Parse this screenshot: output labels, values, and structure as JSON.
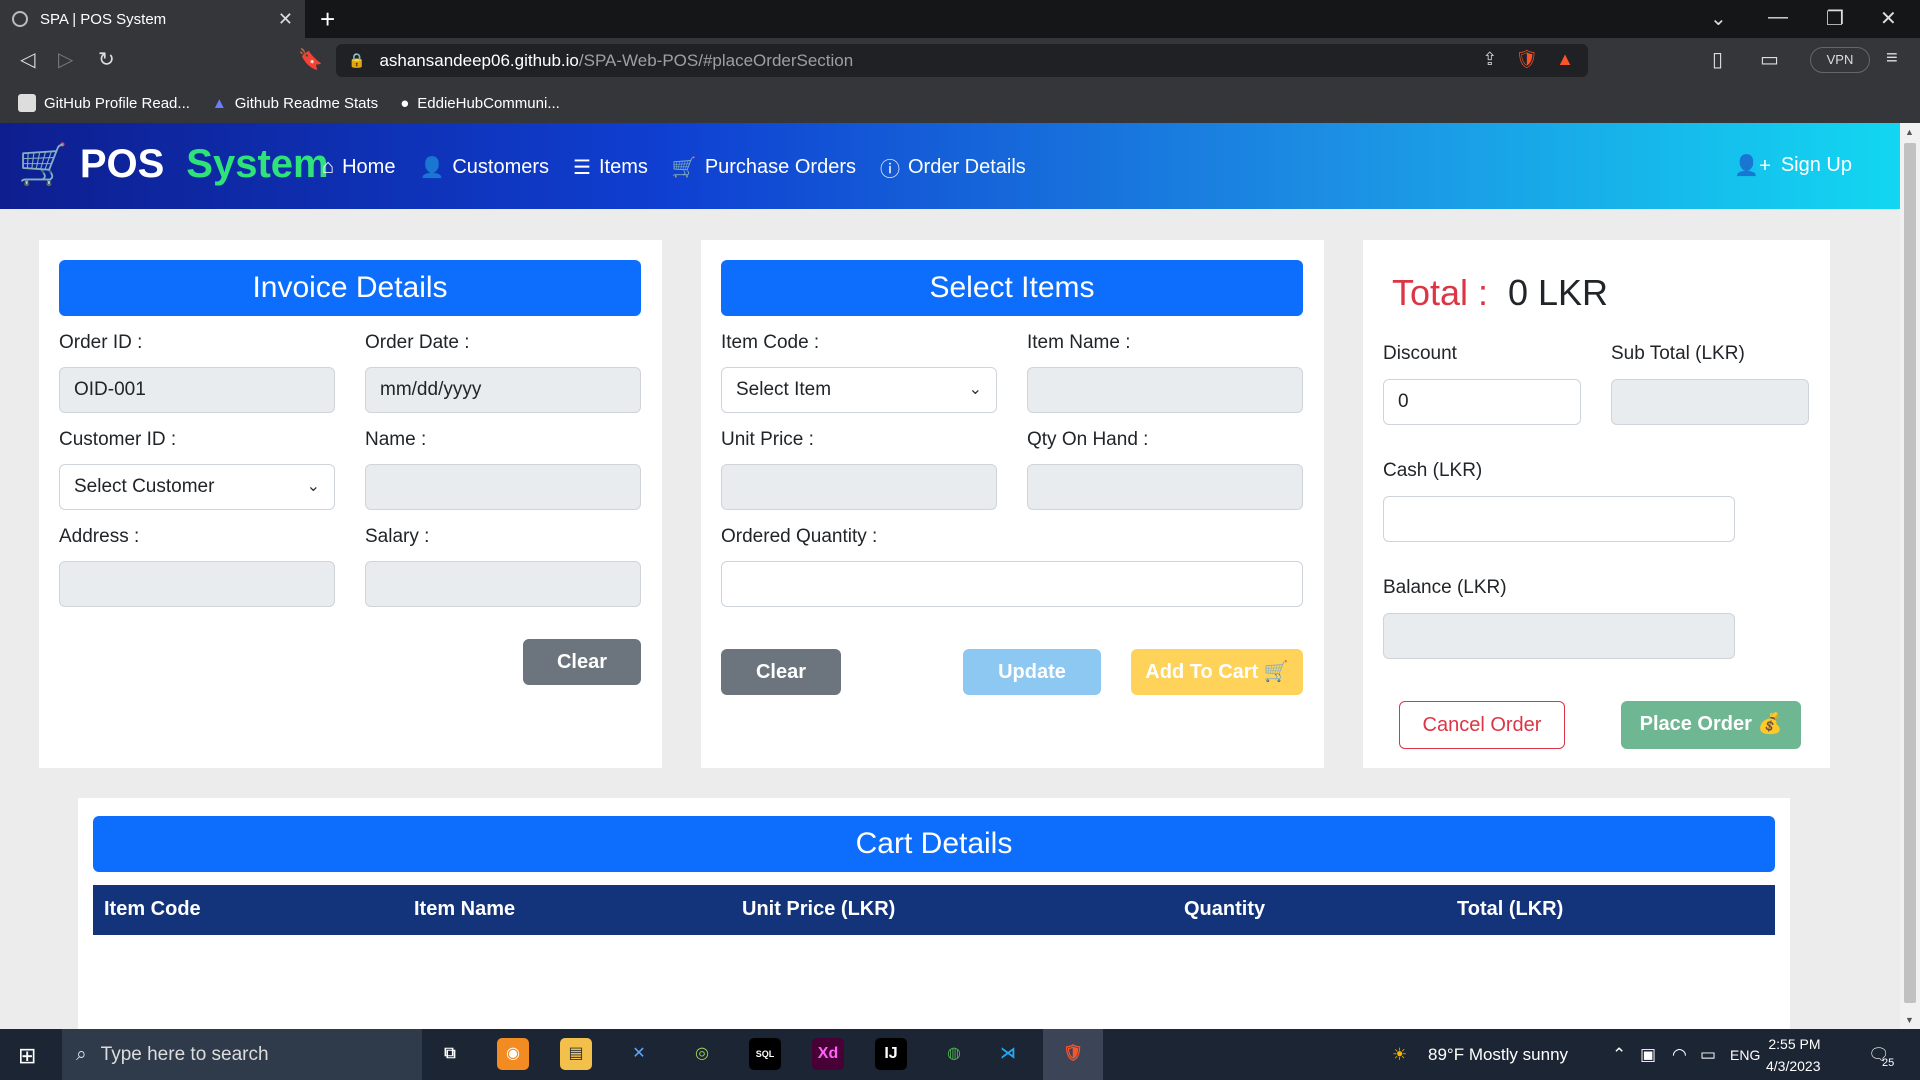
{
  "browser": {
    "tab_title": "SPA | POS System",
    "url_host": "ashansandeep06.github.io",
    "url_path": "/SPA-Web-POS/#placeOrderSection",
    "vpn_label": "VPN",
    "bookmarks": [
      {
        "label": "GitHub Profile Read..."
      },
      {
        "label": "Github Readme Stats"
      },
      {
        "label": "EddieHubCommuni..."
      }
    ]
  },
  "navbar": {
    "brand_pos": "POS",
    "brand_system": "System",
    "links": [
      {
        "label": "Home",
        "icon": "home-icon"
      },
      {
        "label": "Customers",
        "icon": "user-icon"
      },
      {
        "label": "Items",
        "icon": "database-icon"
      },
      {
        "label": "Purchase Orders",
        "icon": "cart-icon"
      },
      {
        "label": "Order Details",
        "icon": "info-icon"
      }
    ],
    "signup_label": "Sign Up"
  },
  "invoice": {
    "title": "Invoice Details",
    "order_id_label": "Order ID :",
    "order_id_value": "OID-001",
    "order_date_label": "Order Date :",
    "order_date_placeholder": "mm/dd/yyyy",
    "customer_id_label": "Customer ID :",
    "customer_select": "Select Customer",
    "name_label": "Name :",
    "address_label": "Address :",
    "salary_label": "Salary :",
    "clear_label": "Clear"
  },
  "items": {
    "title": "Select Items",
    "item_code_label": "Item Code :",
    "item_select": "Select Item",
    "item_name_label": "Item Name :",
    "unit_price_label": "Unit Price :",
    "qty_on_hand_label": "Qty On Hand :",
    "ordered_qty_label": "Ordered Quantity :",
    "clear_label": "Clear",
    "update_label": "Update",
    "add_to_cart_label": "Add To Cart"
  },
  "summary": {
    "total_label": "Total :",
    "total_value": "0 LKR",
    "discount_label": "Discount",
    "discount_value": "0",
    "subtotal_label": "Sub Total (LKR)",
    "cash_label": "Cash (LKR)",
    "balance_label": "Balance (LKR)",
    "cancel_label": "Cancel Order",
    "place_label": "Place Order"
  },
  "cart": {
    "title": "Cart Details",
    "columns": [
      "Item Code",
      "Item Name",
      "Unit Price (LKR)",
      "Quantity",
      "Total (LKR)"
    ]
  },
  "taskbar": {
    "search_placeholder": "Type here to search",
    "weather": "89°F  Mostly sunny",
    "lang": "ENG",
    "time": "2:55 PM",
    "date": "4/3/2023",
    "notif_count": "25"
  },
  "colors": {
    "primary": "#0d6efd",
    "danger": "#dc3545",
    "table_head": "#13337a"
  }
}
